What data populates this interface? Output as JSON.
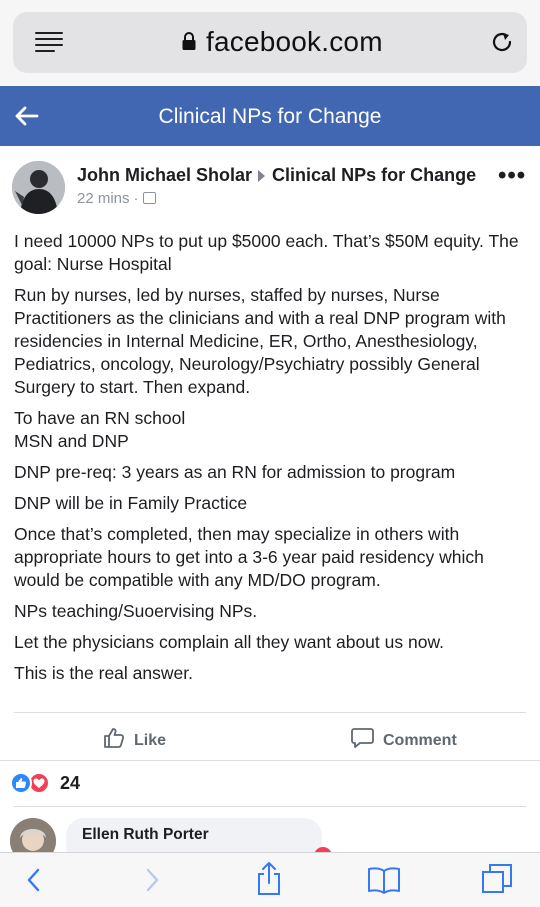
{
  "browser": {
    "url": "facebook.com"
  },
  "group": {
    "title": "Clinical NPs for Change"
  },
  "post": {
    "author": "John Michael Sholar",
    "target_group": "Clinical NPs for Change",
    "time": "22 mins",
    "paragraphs": [
      "I need 10000 NPs to put up $5000 each. That’s $50M equity. The goal: Nurse Hospital",
      "Run by nurses, led by nurses, staffed by nurses, Nurse Practitioners as the clinicians and with a real DNP program with residencies in Internal Medicine, ER, Ortho, Anesthesiology, Pediatrics, oncology, Neurology/Psychiatry possibly General Surgery to start. Then expand.",
      "To have an RN school",
      "MSN and DNP",
      "DNP pre-req: 3 years as an RN for admission to program",
      "DNP will be in Family Practice",
      "Once that’s completed, then may specialize in others with appropriate hours to get into a 3-6 year paid residency which would be compatible with any MD/DO program.",
      "NPs teaching/Suoervising NPs.",
      "Let the physicians complain all they want about us now.",
      "This is the real answer."
    ],
    "actions": {
      "like": "Like",
      "comment": "Comment"
    },
    "reaction_count": "24"
  },
  "comment": {
    "author": "Ellen Ruth Porter"
  },
  "icons": {
    "menu": "reader-menu-icon",
    "lock": "lock-icon",
    "reload": "reload-icon",
    "back": "back-arrow-icon",
    "more": "more-options-icon",
    "like": "thumbs-up-icon",
    "comment": "speech-bubble-icon",
    "toolbar": [
      "back-icon",
      "forward-icon",
      "share-icon",
      "bookmarks-icon",
      "tabs-icon"
    ]
  },
  "colors": {
    "facebook_blue": "#4267b2",
    "like_blue": "#2d88ff",
    "love_red": "#f33e58"
  }
}
